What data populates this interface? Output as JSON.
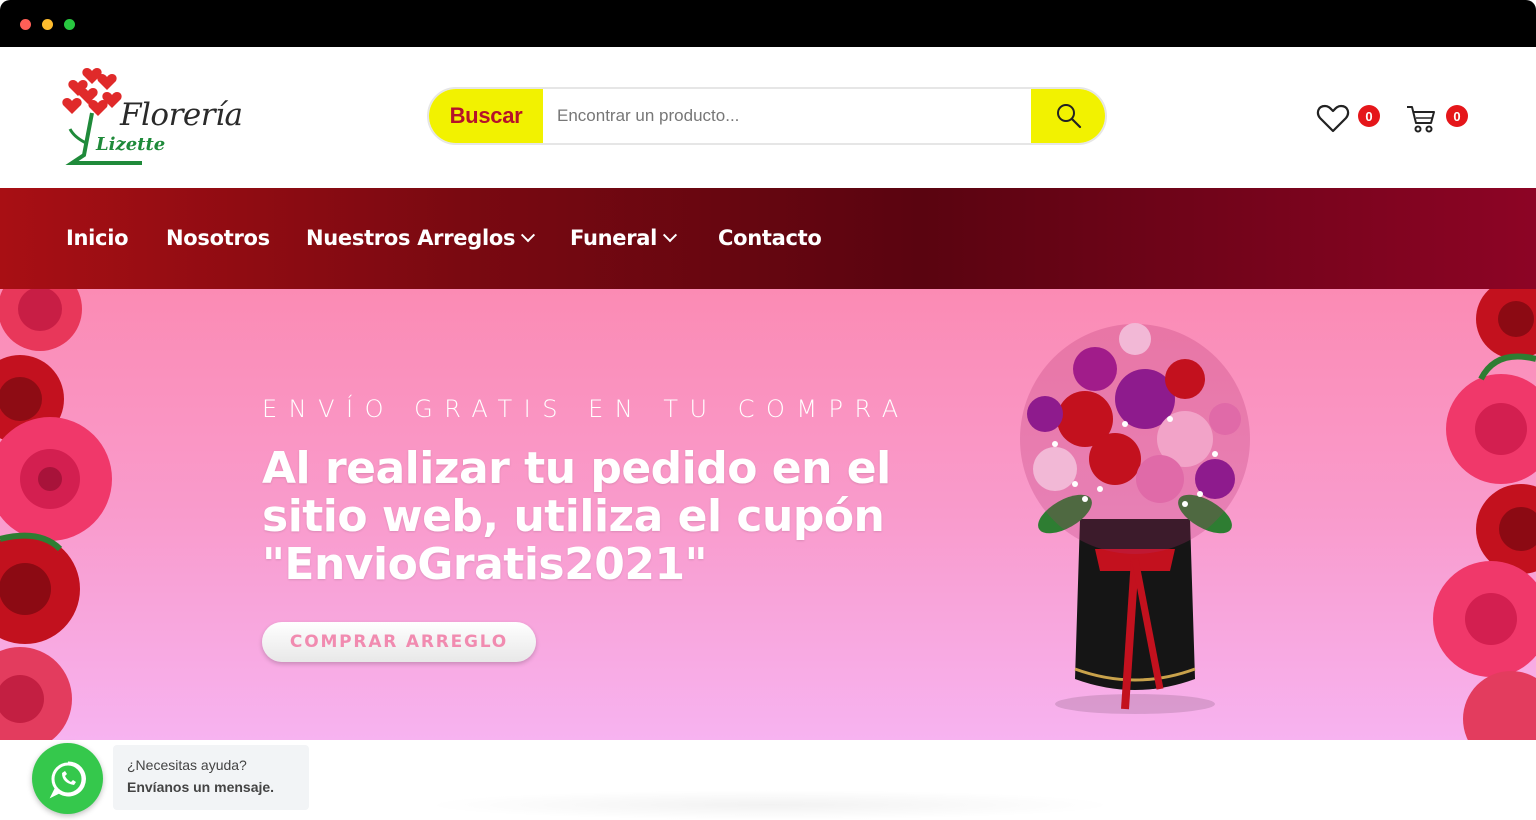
{
  "brand": {
    "name_line1": "Florería",
    "name_line2": "Lizette"
  },
  "search": {
    "label": "Buscar",
    "placeholder": "Encontrar un producto...",
    "submit_icon": "search-icon"
  },
  "header_icons": {
    "wishlist_count": "0",
    "cart_count": "0",
    "wishlist_icon": "heart-icon",
    "cart_icon": "cart-icon"
  },
  "nav": {
    "items": [
      {
        "label": "Inicio"
      },
      {
        "label": "Nosotros"
      },
      {
        "label": "Nuestros Arreglos"
      },
      {
        "label": "Funeral"
      },
      {
        "label": "Contacto"
      }
    ]
  },
  "hero": {
    "kicker": "ENVÍO GRATIS EN TU COMPRA",
    "title": "Al realizar tu pedido en el sitio web, utiliza el cupón \"EnvioGratis2021\"",
    "button": "COMPRAR ARREGLO"
  },
  "whatsapp": {
    "line1": "¿Necesitas ayuda?",
    "line2": "Envíanos un mensaje.",
    "icon": "whatsapp-icon"
  },
  "colors": {
    "accent_yellow": "#f2f200",
    "brand_red": "#b5122a",
    "nav_dark": "#5a0410",
    "hero_pink": "#fb8bb4",
    "badge_red": "#e5161a"
  }
}
